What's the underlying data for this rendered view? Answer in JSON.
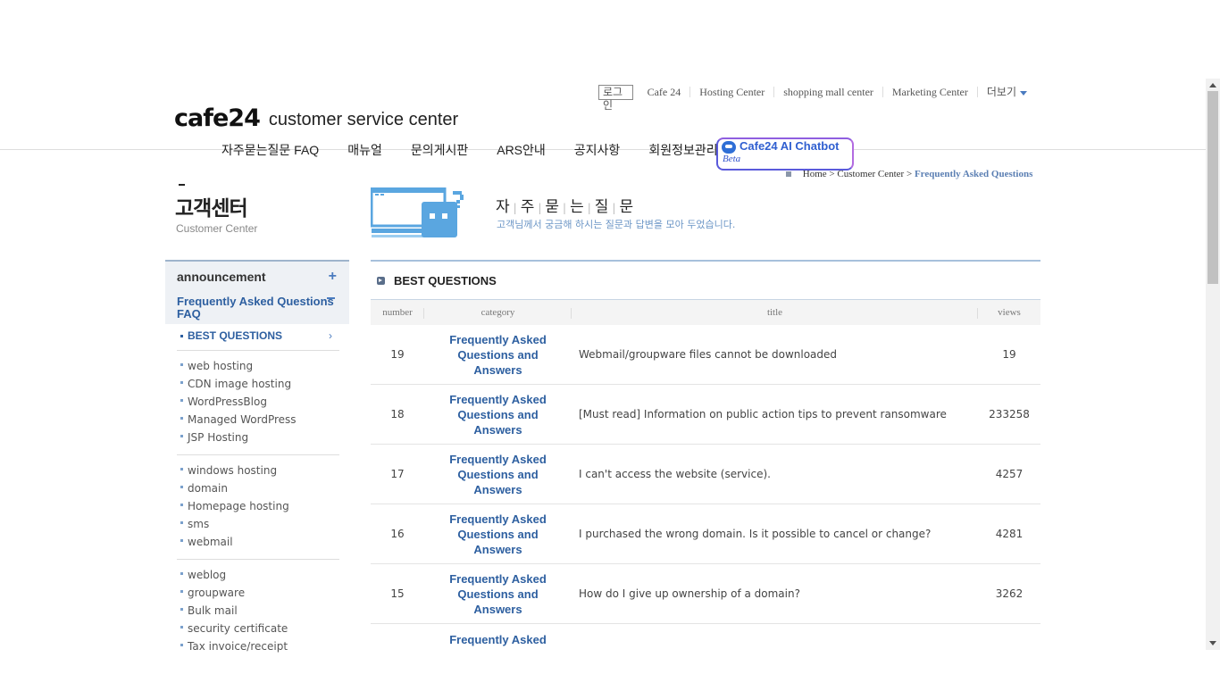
{
  "utility": {
    "login": "로그인",
    "links": [
      "Cafe 24",
      "Hosting Center",
      "shopping mall center",
      "Marketing Center"
    ],
    "more": "더보기"
  },
  "logo": {
    "mark": "cafe24",
    "subtitle": "customer service center"
  },
  "gnb": [
    "자주묻는질문 FAQ",
    "매뉴얼",
    "문의게시판",
    "ARS안내",
    "공지사항",
    "회원정보관리"
  ],
  "chatbot": {
    "label": "Cafe24 AI Chatbot",
    "badge": "Beta"
  },
  "breadcrumb": {
    "home": "Home",
    "sep1": " > ",
    "center": "Customer Center",
    "sep2": " > ",
    "current": "Frequently Asked Questions"
  },
  "left": {
    "title": "고객센터",
    "subtitle": "Customer Center",
    "announcement": "announcement",
    "faq_line1": "Frequently Asked Questions",
    "faq_line2": "FAQ",
    "best": "BEST QUESTIONS",
    "groups": [
      [
        "web hosting",
        "CDN image hosting",
        "WordPressBlog",
        "Managed WordPress",
        "JSP Hosting"
      ],
      [
        "windows hosting",
        "domain",
        "Homepage hosting",
        "sms",
        "webmail"
      ],
      [
        "weblog",
        "groupware",
        "Bulk mail",
        "security certificate",
        "Tax invoice/receipt"
      ]
    ]
  },
  "content": {
    "title_chars": [
      "자",
      "주",
      "묻",
      "는",
      "질",
      "문"
    ],
    "description": "고객님께서 궁금해 하시는 질문과 답변을 모아 두었습니다.",
    "board_title": "BEST QUESTIONS",
    "columns": {
      "number": "number",
      "category": "category",
      "title": "title",
      "views": "views"
    },
    "rows": [
      {
        "number": "19",
        "category": "Frequently Asked Questions and Answers",
        "title": "Webmail/groupware files cannot be downloaded",
        "views": "19"
      },
      {
        "number": "18",
        "category": "Frequently Asked Questions and Answers",
        "title": "[Must read] Information on public action tips to prevent ransomware",
        "views": "233258"
      },
      {
        "number": "17",
        "category": "Frequently Asked Questions and Answers",
        "title": "I can't access the website (service).",
        "views": "4257"
      },
      {
        "number": "16",
        "category": "Frequently Asked Questions and Answers",
        "title": "I purchased the wrong domain. Is it possible to cancel or change?",
        "views": "4281"
      },
      {
        "number": "15",
        "category": "Frequently Asked Questions and Answers",
        "title": "How do I give up ownership of a domain?",
        "views": "3262"
      },
      {
        "number": "",
        "category": "Frequently Asked",
        "title": "",
        "views": ""
      }
    ]
  },
  "colors": {
    "accent": "#2d5fa0",
    "light_blue": "#6c96c6",
    "illustration": "#5aa6e0"
  }
}
